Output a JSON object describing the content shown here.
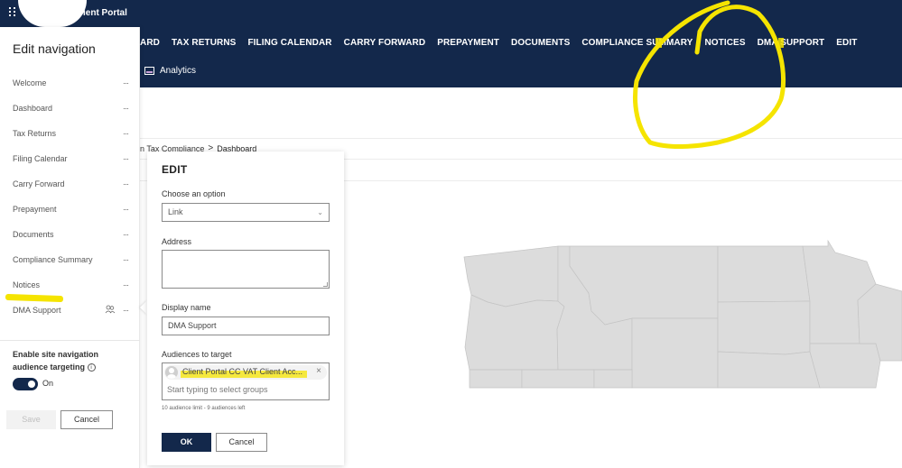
{
  "header": {
    "site_title": "ient Portal",
    "top_nav": [
      "ARD",
      "TAX RETURNS",
      "FILING CALENDAR",
      "CARRY FORWARD",
      "PREPAYMENT",
      "DOCUMENTS",
      "COMPLIANCE SUMMARY",
      "NOTICES",
      "DMA SUPPORT",
      "EDIT"
    ],
    "sub_nav": {
      "label": "Analytics",
      "icon": "analytics-icon"
    }
  },
  "breadcrumb": {
    "parent": "n Tax Compliance",
    "separator": ">",
    "current": "Dashboard"
  },
  "edit_navigation": {
    "title": "Edit navigation",
    "items": [
      {
        "label": "Welcome",
        "more": "···"
      },
      {
        "label": "Dashboard",
        "more": "···"
      },
      {
        "label": "Tax Returns",
        "more": "···"
      },
      {
        "label": "Filing Calendar",
        "more": "···"
      },
      {
        "label": "Carry Forward",
        "more": "···"
      },
      {
        "label": "Prepayment",
        "more": "···"
      },
      {
        "label": "Documents",
        "more": "···"
      },
      {
        "label": "Compliance Summary",
        "more": "···"
      },
      {
        "label": "Notices",
        "more": "···"
      },
      {
        "label": "DMA Support",
        "more": "···",
        "audience_icon": "people-icon"
      }
    ],
    "audience_targeting_label": "Enable site navigation audience targeting",
    "info_icon": "i",
    "toggle": {
      "state": true,
      "label": "On"
    },
    "save_label": "Save",
    "cancel_label": "Cancel"
  },
  "edit_dialog": {
    "title": "EDIT",
    "choose_option_label": "Choose an option",
    "choose_option_value": "Link",
    "address_label": "Address",
    "address_value": "",
    "display_name_label": "Display name",
    "display_name_value": "DMA Support",
    "audiences_label": "Audiences to target",
    "audience_chip": "Client Portal CC VAT Client Acc...",
    "audience_chip_remove": "×",
    "audience_placeholder": "Start typing to select groups",
    "audience_limit": "10 audience limit - 9 audiences left",
    "ok_label": "OK",
    "cancel_label": "Cancel"
  },
  "colors": {
    "header_bg": "#13284b",
    "primary_button": "#13284b",
    "highlight": "#f5e400",
    "map_fill": "#dcdcdc"
  }
}
